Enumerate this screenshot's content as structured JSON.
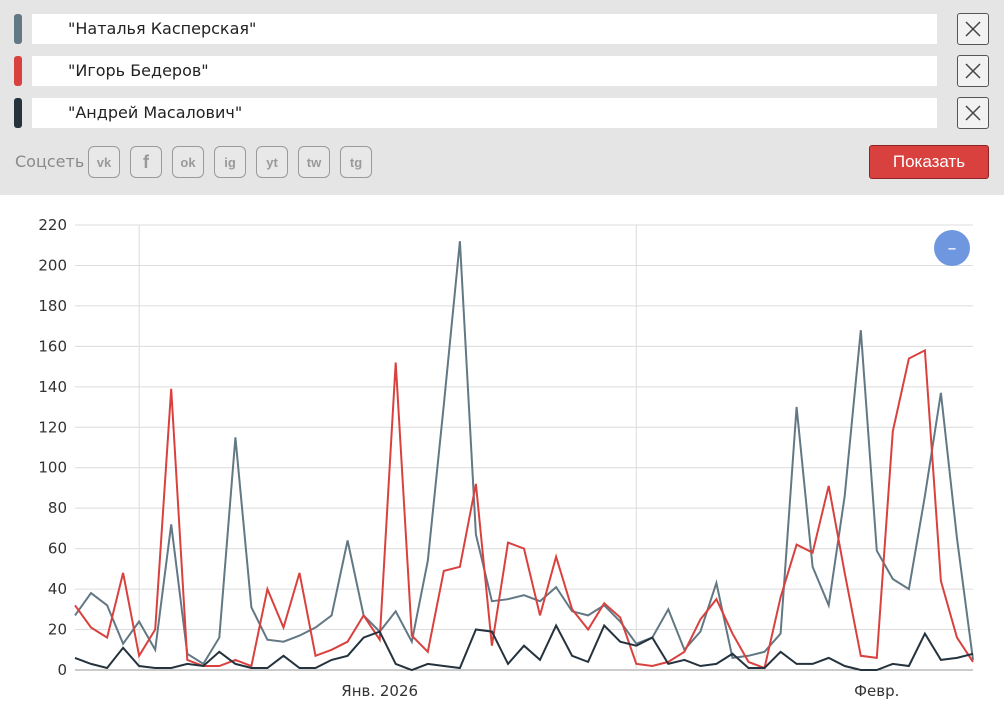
{
  "queries": [
    {
      "label": "\"Наталья Касперская\"",
      "color": "#627884"
    },
    {
      "label": "\"Игорь Бедеров\"",
      "color": "#d9413f"
    },
    {
      "label": "\"Андрей Масалович\"",
      "color": "#24333e"
    }
  ],
  "social": {
    "label": "Соцсеть",
    "networks": [
      {
        "name": "vk-icon",
        "glyph": "vk"
      },
      {
        "name": "facebook-icon",
        "glyph": "f"
      },
      {
        "name": "odnoklassniki-icon",
        "glyph": "ok"
      },
      {
        "name": "instagram-icon",
        "glyph": "ig"
      },
      {
        "name": "youtube-icon",
        "glyph": "yt"
      },
      {
        "name": "twitter-icon",
        "glyph": "tw"
      },
      {
        "name": "telegram-icon",
        "glyph": "tg"
      }
    ]
  },
  "show_button": "Показать",
  "zoom_button": "–",
  "chart_data": {
    "type": "line",
    "ylim": [
      0,
      220
    ],
    "yticks": [
      0,
      20,
      40,
      60,
      80,
      100,
      120,
      140,
      160,
      180,
      200,
      220
    ],
    "x_labels": [
      {
        "label": "Янв. 2026",
        "index": 19
      },
      {
        "label": "Февр.",
        "index": 50
      }
    ],
    "vertical_grid_indices": [
      4,
      35
    ],
    "grid": true,
    "series": [
      {
        "name": "\"Наталья Касперская\"",
        "color": "#627884",
        "values": [
          27,
          38,
          32,
          13,
          24,
          10,
          72,
          8,
          3,
          16,
          115,
          31,
          15,
          14,
          17,
          21,
          27,
          64,
          27,
          19,
          29,
          14,
          54,
          131,
          212,
          67,
          34,
          35,
          37,
          34,
          41,
          29,
          27,
          32,
          24,
          13,
          16,
          30,
          10,
          19,
          43,
          6,
          7,
          9,
          18,
          130,
          51,
          32,
          86,
          168,
          59,
          45,
          40,
          86,
          137,
          65,
          5
        ]
      },
      {
        "name": "\"Игорь Бедеров\"",
        "color": "#d9413f",
        "values": [
          32,
          21,
          16,
          48,
          7,
          20,
          139,
          5,
          2,
          2,
          5,
          2,
          40,
          21,
          48,
          7,
          10,
          14,
          27,
          15,
          152,
          17,
          9,
          49,
          51,
          92,
          12,
          63,
          60,
          27,
          56,
          30,
          20,
          33,
          26,
          3,
          2,
          4,
          9,
          25,
          35,
          18,
          4,
          1,
          36,
          62,
          58,
          91,
          48,
          7,
          6,
          118,
          154,
          158,
          44,
          16,
          4
        ]
      },
      {
        "name": "\"Андрей Масалович\"",
        "color": "#24333e",
        "values": [
          6,
          3,
          1,
          11,
          2,
          1,
          1,
          3,
          2,
          9,
          3,
          1,
          1,
          7,
          1,
          1,
          5,
          7,
          16,
          19,
          3,
          0,
          3,
          2,
          1,
          20,
          19,
          3,
          12,
          5,
          22,
          7,
          4,
          22,
          14,
          12,
          16,
          3,
          5,
          2,
          3,
          8,
          1,
          1,
          9,
          3,
          3,
          6,
          2,
          0,
          0,
          3,
          2,
          18,
          5,
          6,
          8
        ]
      }
    ]
  }
}
